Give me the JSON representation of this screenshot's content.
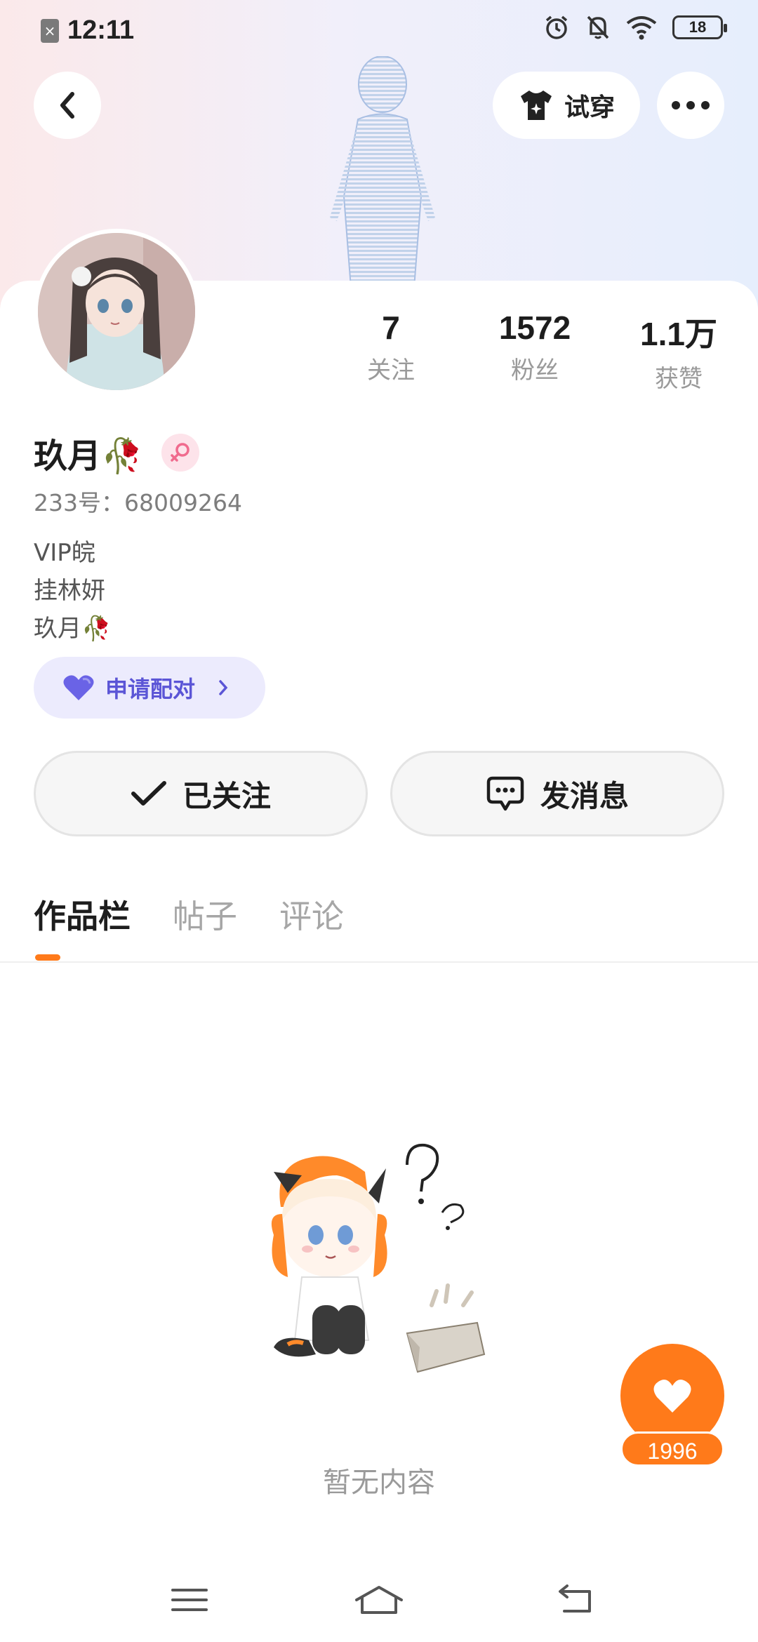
{
  "status_bar": {
    "time": "12:11",
    "battery_level": "18",
    "sim_icon": "no-sim-icon",
    "icons": [
      "alarm-icon",
      "mute-bell-icon",
      "wifi-icon",
      "battery-icon"
    ]
  },
  "header": {
    "tryon_label": "试穿",
    "tryon_icon": "tshirt-icon",
    "back_icon": "chevron-left-icon",
    "more_icon": "more-dots-icon"
  },
  "stats": [
    {
      "value": "7",
      "label": "关注"
    },
    {
      "value": "1572",
      "label": "粉丝"
    },
    {
      "value": "1.1万",
      "label": "获赞"
    }
  ],
  "profile": {
    "username": "玖月🥀",
    "gender": "female",
    "id_line": "233号：68009264",
    "bio": [
      "VIP皖",
      "挂林妍",
      "玖月🥀"
    ]
  },
  "pair_button": {
    "label": "申请配对",
    "icon": "heart-icon"
  },
  "actions": {
    "follow_label": "已关注",
    "message_label": "发消息"
  },
  "tabs": [
    {
      "label": "作品栏",
      "active": true
    },
    {
      "label": "帖子",
      "active": false
    },
    {
      "label": "评论",
      "active": false
    }
  ],
  "empty_state": {
    "text": "暂无内容"
  },
  "like_fab": {
    "count": "1996"
  },
  "colors": {
    "accent": "#ff7a1a",
    "pair_text": "#5b55d6",
    "pair_bg": "#ecebfd"
  }
}
